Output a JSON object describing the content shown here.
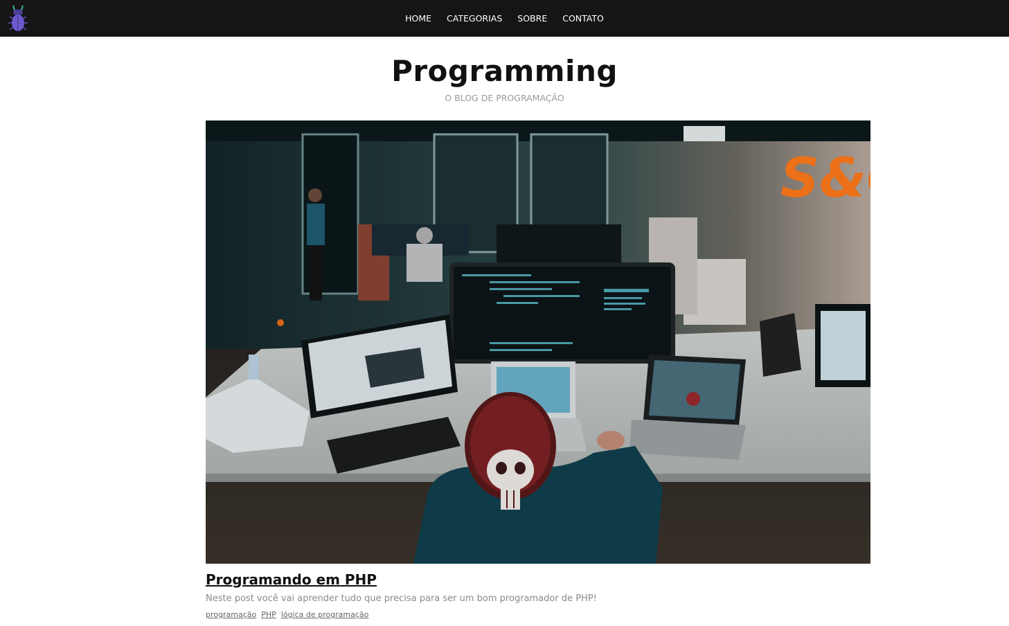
{
  "header": {
    "logo_icon": "bug-icon",
    "logo_color": "#6a5acd",
    "nav": [
      {
        "label": "HOME"
      },
      {
        "label": "CATEGORIAS"
      },
      {
        "label": "SOBRE"
      },
      {
        "label": "CONTATO"
      }
    ]
  },
  "site": {
    "title": "Programming",
    "subtitle": "O BLOG DE PROGRAMAÇÃO"
  },
  "post": {
    "image_icon": "programmer-workspace-photo",
    "title": "Programando em PHP",
    "excerpt": "Neste post você vai aprender tudo que precisa para ser um bom programador de PHP!",
    "tags": [
      "programação",
      "PHP",
      "lógica de programação"
    ]
  }
}
